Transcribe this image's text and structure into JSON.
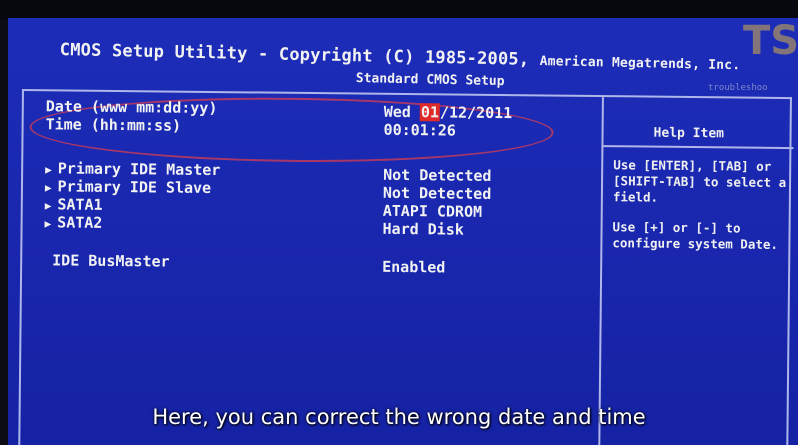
{
  "header": {
    "title_part1": "CMOS Setup Utility - Copyright (C) 1985-2005, ",
    "title_part2": "American Megatrends, Inc.",
    "subtitle": "Standard CMOS Setup"
  },
  "watermark": {
    "logo": "TS",
    "sub": "troubleshoo"
  },
  "fields": {
    "date_label": "Date (www mm:dd:yy)",
    "date_day": "Wed ",
    "date_month": "01",
    "date_rest": "/12/2011",
    "time_label": "Time (hh:mm:ss)",
    "time_value": "00:01:26",
    "drives": [
      {
        "label": "Primary IDE Master",
        "value": "Not Detected"
      },
      {
        "label": "Primary IDE Slave",
        "value": "Not Detected"
      },
      {
        "label": "SATA1",
        "value": "ATAPI CDROM"
      },
      {
        "label": "SATA2",
        "value": "Hard Disk"
      }
    ],
    "busmaster_label": "IDE BusMaster",
    "busmaster_value": "Enabled"
  },
  "help": {
    "title": "Help Item",
    "text1": "Use [ENTER], [TAB] or [SHIFT-TAB] to select a field.",
    "text2": "Use [+] or [-] to configure system Date."
  },
  "caption": "Here, you can correct the wrong date and time",
  "colors": {
    "background": "#1a28b0",
    "highlight": "#e02a2a",
    "text": "#f2f2f2"
  }
}
